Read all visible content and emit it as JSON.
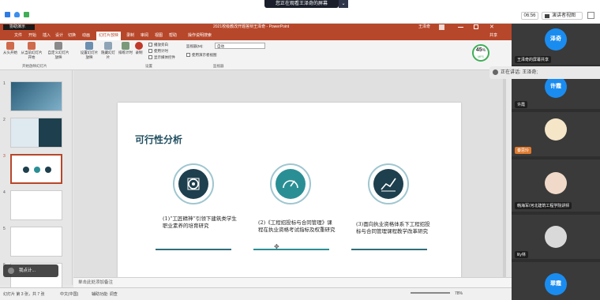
{
  "topbar": {
    "share_banner": "您正在观看王泽奇的屏幕",
    "time": "06:56",
    "view_label": "演讲者视图"
  },
  "ppt": {
    "title": "2021校级教改开题答辩王泽奇 - PowerPoint",
    "user": "王泽奇",
    "collab": "协助演示",
    "share": "共享",
    "tabs": [
      "文件",
      "开始",
      "插入",
      "设计",
      "切换",
      "动画",
      "幻灯片放映",
      "录制",
      "审阅",
      "视图",
      "帮助",
      "操作说明搜索"
    ],
    "active_tab": "幻灯片放映",
    "ribbon": {
      "from_start": "从头开始",
      "from_current": "从当前幻灯片开始",
      "custom": "自定义幻灯片放映",
      "setup": "设置幻灯片放映",
      "hide": "隐藏幻灯片",
      "rehearse": "排练计时",
      "record": "录制",
      "play_narration": "播放旁白",
      "use_timing": "使用计时",
      "show_media": "显示媒体控件",
      "monitor_label": "监视器(M):",
      "monitor_value": "自动",
      "presenter_view": "使用演示者视图",
      "group_start": "开始放映幻灯片",
      "group_setup": "设置",
      "group_monitor": "监视器"
    },
    "slide": {
      "title": "可行性分析",
      "items": [
        {
          "text": "(1)“工匠精神”引领下建筑类学生职业素养的培育研究"
        },
        {
          "text": "(2)《工程招投标与合同管理》课程在执业资格考试指标及权重研究"
        },
        {
          "text": "(3)面向执业资格体系下工程招投标与合同管理课程教学改革研究"
        }
      ]
    },
    "notes_placeholder": "单击此处添加备注",
    "status": {
      "slide_info": "幻灯片 第 3 张，共 7 张",
      "lang": "中文(中国)",
      "accessibility": "辅助功能: 调查",
      "zoom": "78%"
    },
    "thumbs": [
      "1",
      "2",
      "3",
      "4",
      "5",
      "6"
    ],
    "stop_sharing": "我点计..."
  },
  "percent_badge": {
    "value": "45",
    "unit": "%",
    "sub": "MFS"
  },
  "participants": {
    "p1": {
      "avatar": "泽奇",
      "label": "王泽奇的屏幕共享"
    },
    "speaking": "正在讲话: 王泽奇;",
    "p2": {
      "avatar": "许霞",
      "label": "许霞"
    },
    "p3": {
      "label": "秦思玲"
    },
    "p4": {
      "label": "韩海军/河北建筑工程学院讲师"
    },
    "p5": {
      "label": "lily林"
    },
    "p6": {
      "avatar": "翠霞"
    }
  },
  "colors": {
    "ppt_red": "#b7472a",
    "teal": "#2a8f95",
    "navy": "#1e3f4d",
    "zoom_blue": "#1a8cf0"
  }
}
